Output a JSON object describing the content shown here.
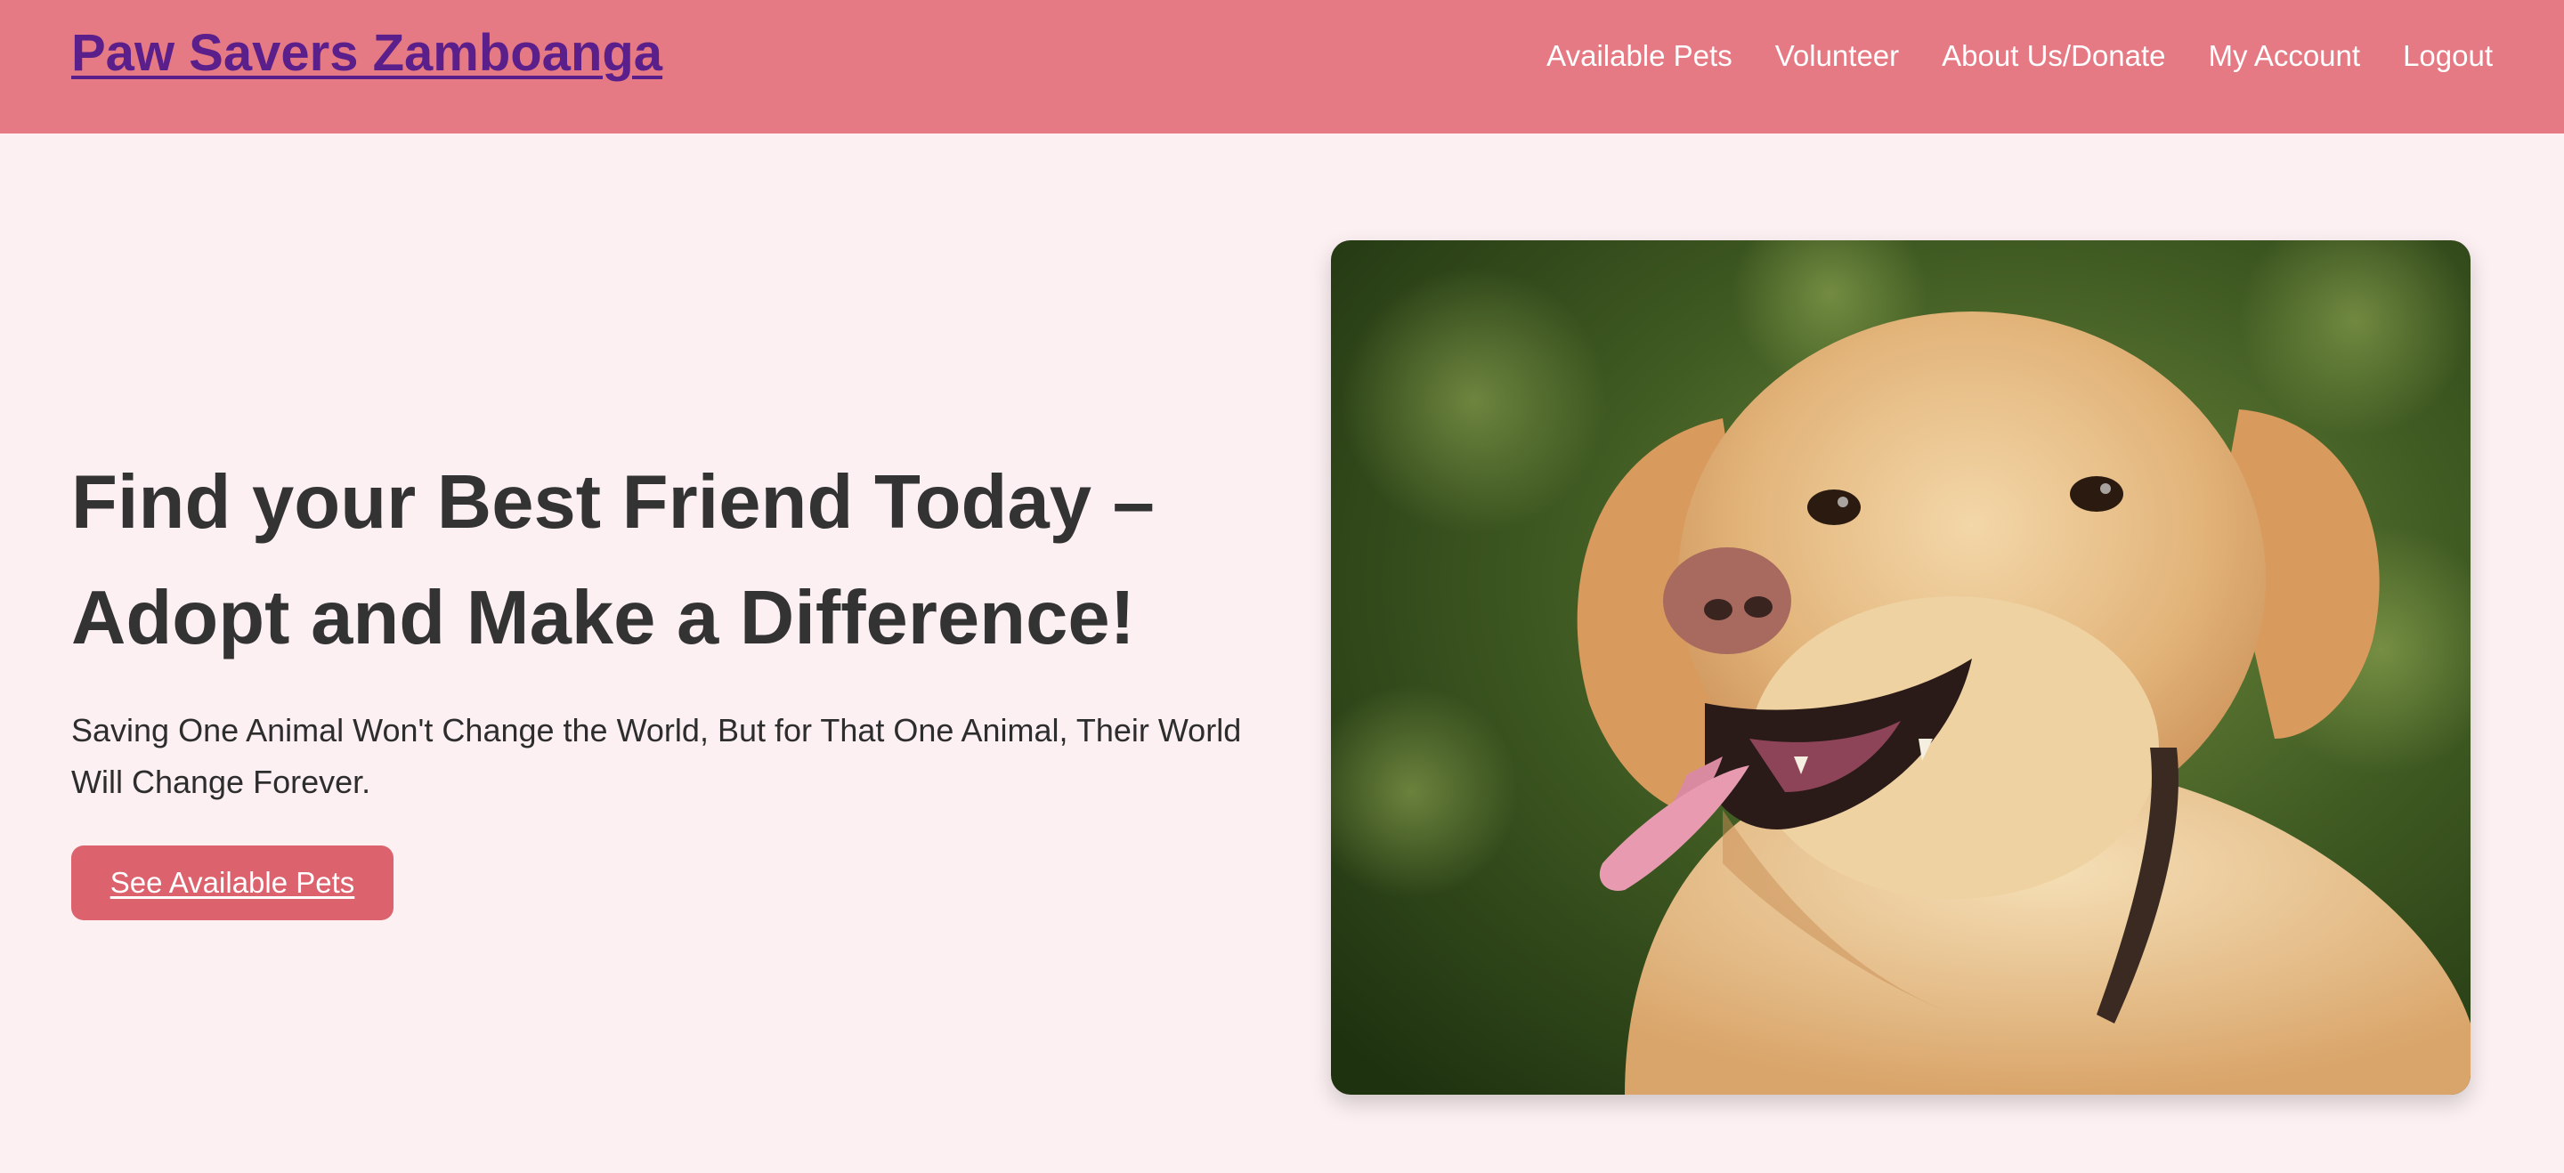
{
  "header": {
    "site_title": "Paw Savers Zamboanga",
    "nav": [
      {
        "label": "Available Pets"
      },
      {
        "label": "Volunteer"
      },
      {
        "label": "About Us/Donate"
      },
      {
        "label": "My Account"
      },
      {
        "label": "Logout"
      }
    ]
  },
  "hero": {
    "title_line1": "Find your Best Friend Today –",
    "title_line2": "Adopt and Make a Difference!",
    "subtitle": "Saving One Animal Won't Change the World, But for That One Animal, Their World Will Change Forever.",
    "cta_label": "See Available Pets",
    "image_subject": "golden-retriever-dog-photo"
  },
  "colors": {
    "header_bg": "#e67a84",
    "title_link": "#5a1f8a",
    "page_bg": "#fcf0f2",
    "button_bg": "#dc626e",
    "heading_text": "#333333"
  }
}
